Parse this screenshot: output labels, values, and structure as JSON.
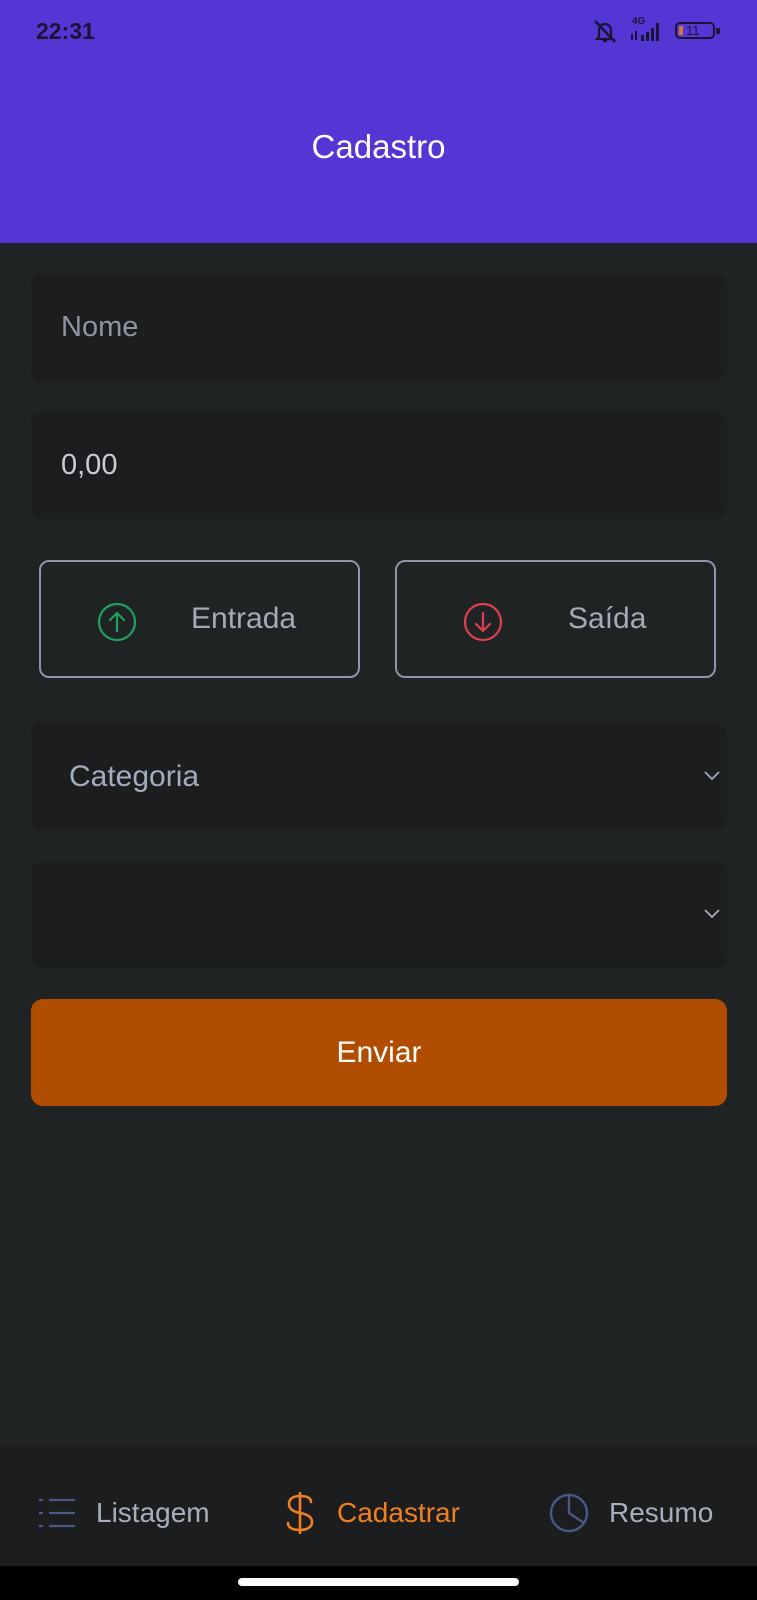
{
  "status_bar": {
    "time": "22:31",
    "network": "4G",
    "battery": "11",
    "icons": [
      "notifications-off-icon",
      "signal-icon",
      "battery-icon"
    ]
  },
  "header": {
    "title": "Cadastro"
  },
  "form": {
    "name_field": {
      "placeholder": "Nome",
      "value": ""
    },
    "amount_field": {
      "placeholder": "",
      "value": "0,00"
    },
    "type_buttons": {
      "income": {
        "label": "Entrada",
        "icon": "arrow-up-circle-icon",
        "color": "#1fa05f"
      },
      "expense": {
        "label": "Saída",
        "icon": "arrow-down-circle-icon",
        "color": "#e23d50"
      }
    },
    "category_select": {
      "label": "Categoria"
    },
    "second_select": {
      "label": ""
    },
    "submit_label": "Enviar"
  },
  "bottom_nav": {
    "items": [
      {
        "label": "Listagem",
        "icon": "list-icon",
        "active": false
      },
      {
        "label": "Cadastrar",
        "icon": "dollar-icon",
        "active": true
      },
      {
        "label": "Resumo",
        "icon": "pie-chart-icon",
        "active": false
      }
    ]
  },
  "colors": {
    "header": "#5336d3",
    "background": "#202324",
    "field": "#1c1d1f",
    "submit": "#b14d00",
    "active_nav": "#f07f20",
    "inactive_nav": "#a8afbc"
  }
}
